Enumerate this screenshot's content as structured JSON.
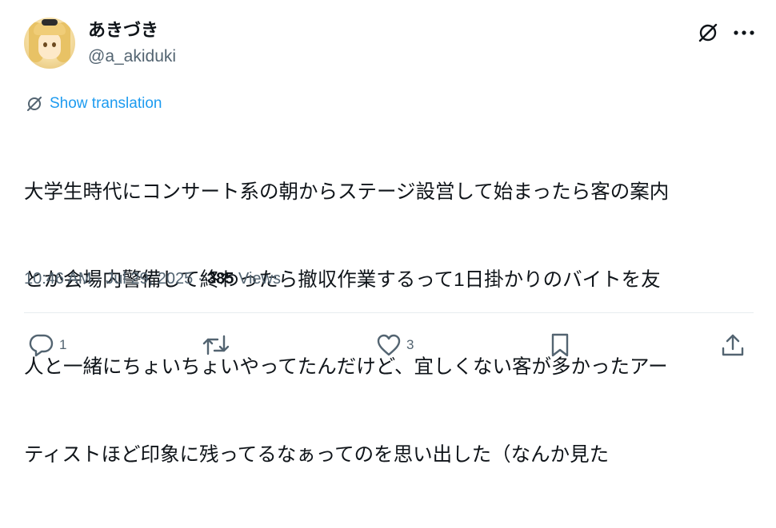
{
  "author": {
    "display_name": "あきづき",
    "handle": "@a_akiduki",
    "avatar_icon": "avatar-anime-character"
  },
  "header_actions": {
    "grok_icon": "grok-icon",
    "more_icon": "more-icon"
  },
  "translate": {
    "label": "Show translation",
    "icon": "translate-icon"
  },
  "body": {
    "lines": [
      "大学生時代にコンサート系の朝からステージ設営して始まったら客の案内",
      "とか会場内警備して終わったら撤収作業するって1日掛かりのバイトを友",
      "人と一緒にちょいちょいやってたんだけど、宜しくない客が多かったアー",
      "ティストほど印象に残ってるなぁってのを思い出した（なんか見た"
    ]
  },
  "meta": {
    "time": "10:46 AM",
    "separator": " · ",
    "date": "Jul 29, 2025",
    "views_count": "385",
    "views_label": " Views"
  },
  "actions": {
    "reply": {
      "icon": "reply-icon",
      "count": "1"
    },
    "retweet": {
      "icon": "retweet-icon",
      "count": ""
    },
    "like": {
      "icon": "heart-icon",
      "count": "3"
    },
    "bookmark": {
      "icon": "bookmark-icon"
    },
    "share": {
      "icon": "share-icon"
    }
  },
  "colors": {
    "text": "#0f1419",
    "secondary": "#536471",
    "link": "#1d9bf0",
    "divider": "#e7ecef"
  }
}
